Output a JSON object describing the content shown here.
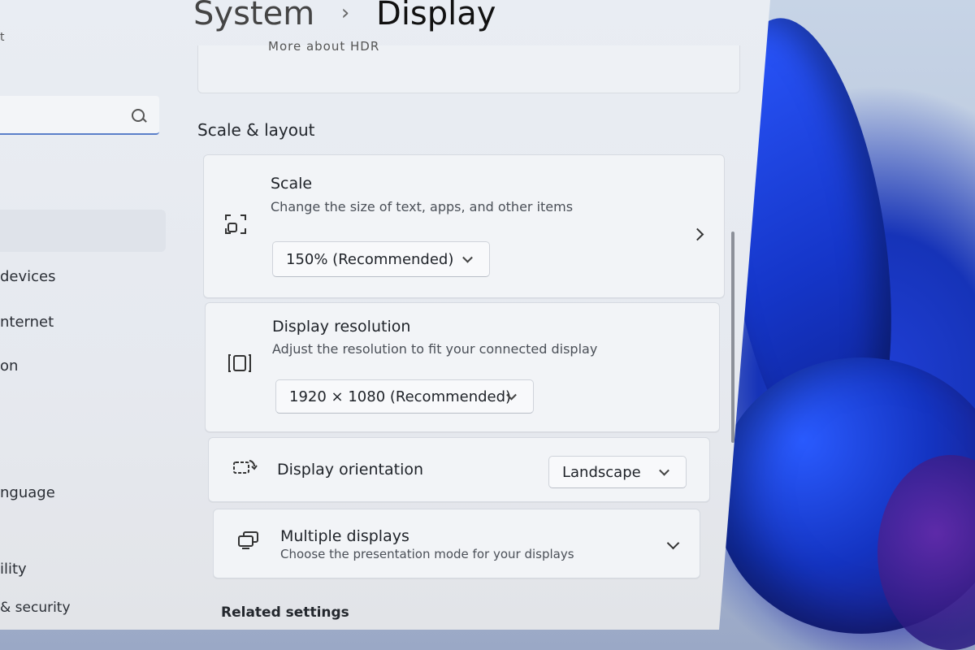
{
  "window": {
    "breadcrumb_parent": "System",
    "breadcrumb_separator": "›",
    "page_title": "Display"
  },
  "sidebar": {
    "top_fragment": "t",
    "items": [
      {
        "label": "devices"
      },
      {
        "label": "nternet"
      },
      {
        "label": "on"
      },
      {
        "label": "nguage"
      },
      {
        "label": "ility"
      },
      {
        "label": "& security"
      }
    ]
  },
  "hdr": {
    "link_label": "More about HDR"
  },
  "scale_layout": {
    "section_title": "Scale & layout",
    "scale": {
      "title": "Scale",
      "description": "Change the size of text, apps, and other items",
      "value": "150% (Recommended)"
    },
    "resolution": {
      "title": "Display resolution",
      "description": "Adjust the resolution to fit your connected display",
      "value": "1920 × 1080 (Recommended)"
    },
    "orientation": {
      "title": "Display orientation",
      "value": "Landscape"
    },
    "multiple": {
      "title": "Multiple displays",
      "description": "Choose the presentation mode for your displays"
    }
  },
  "related": {
    "section_title": "Related settings"
  },
  "icons": {
    "search": "search-icon",
    "scale": "scale-icon",
    "resolution": "resolution-icon",
    "orientation": "orientation-icon",
    "multiple": "multiple-displays-icon"
  },
  "colors": {
    "accent": "#5a7fc9",
    "window_bg": "#e9edf3",
    "card_bg": "#f2f4f7",
    "wallpaper_blue": "#1f3fd6"
  }
}
